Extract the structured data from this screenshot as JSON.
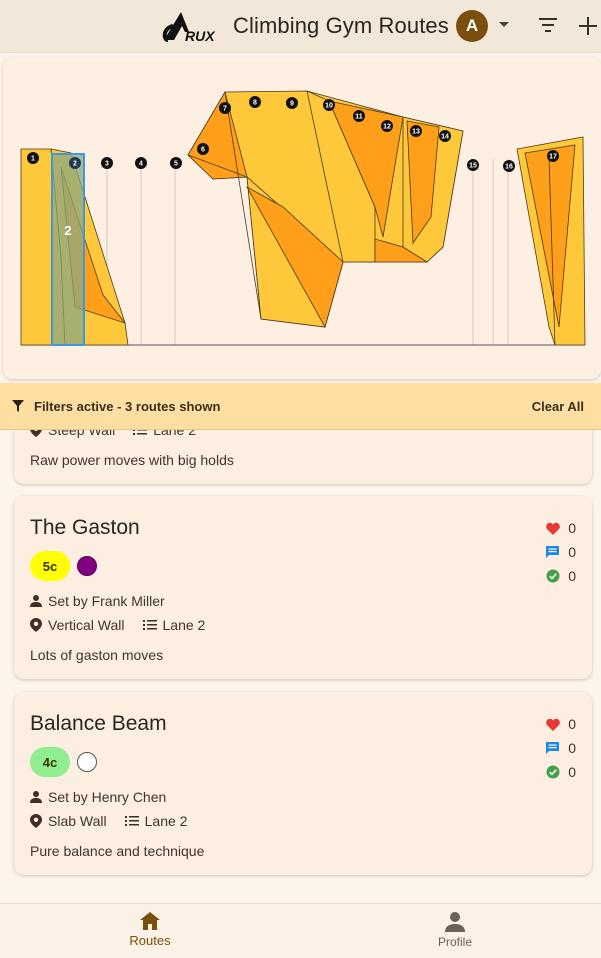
{
  "app": {
    "title": "Climbing Gym Routes",
    "logo_text": "RUX",
    "avatar_initial": "A"
  },
  "wall_map": {
    "selected_route_label": "2",
    "route_markers": [
      "1",
      "2",
      "3",
      "4",
      "5",
      "6",
      "7",
      "8",
      "9",
      "10",
      "11",
      "12",
      "13",
      "14",
      "15",
      "16",
      "17"
    ]
  },
  "filter_banner": {
    "text": "Filters active - 3 routes shown",
    "clear_label": "Clear All"
  },
  "routes": [
    {
      "name": "",
      "wall": "Steep Wall",
      "lane": "Lane 2",
      "description": "Raw power moves with big holds"
    },
    {
      "name": "The Gaston",
      "grade": "5c",
      "grade_color": "#ffff00",
      "hold_color": "#800080",
      "setter": "Set by Frank Miller",
      "wall": "Vertical Wall",
      "lane": "Lane 2",
      "description": "Lots of gaston moves",
      "likes": "0",
      "comments": "0",
      "sends": "0"
    },
    {
      "name": "Balance Beam",
      "grade": "4c",
      "grade_color": "#90ee90",
      "hold_color": "#ffffff",
      "setter": "Set by Henry Chen",
      "wall": "Slab Wall",
      "lane": "Lane 2",
      "description": "Pure balance and technique",
      "likes": "0",
      "comments": "0",
      "sends": "0"
    }
  ],
  "nav": {
    "routes_label": "Routes",
    "profile_label": "Profile"
  },
  "colors": {
    "accent": "#7a4f0e",
    "banner": "#ffdea2",
    "wall_light": "#ffc83a",
    "wall_dark": "#ff9f1a",
    "selected": "#4aa3e0",
    "like": "#e53935",
    "comment": "#1e88e5",
    "send": "#43a047"
  }
}
